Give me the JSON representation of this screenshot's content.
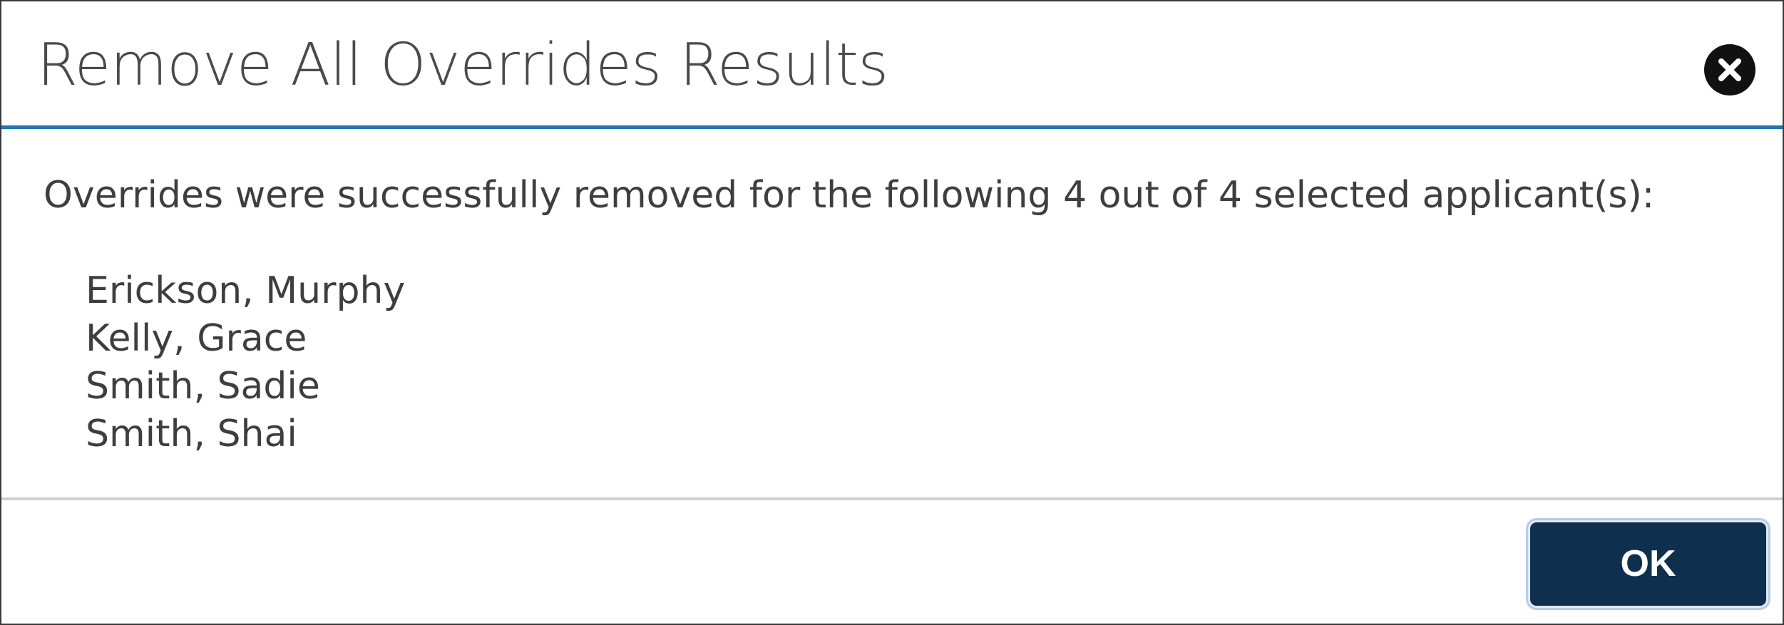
{
  "dialog": {
    "title": "Remove All Overrides Results",
    "close_icon": "close-icon",
    "message": "Overrides were successfully removed for the following 4 out of 4 selected applicant(s):",
    "applicants": [
      "Erickson, Murphy",
      "Kelly, Grace",
      "Smith, Sadie",
      "Smith, Shai"
    ],
    "ok_label": "OK"
  },
  "colors": {
    "header_rule": "#1f78b4",
    "ok_button_bg": "#0f2f4f",
    "text": "#3e3e3e"
  }
}
